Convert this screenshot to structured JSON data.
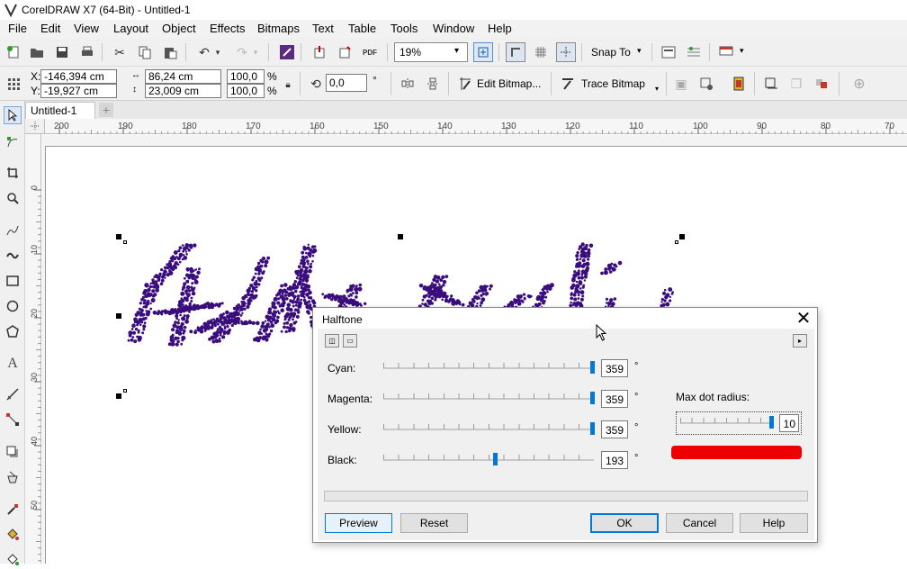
{
  "app": {
    "title": "CorelDRAW X7 (64-Bit) - Untitled-1"
  },
  "menu": [
    "File",
    "Edit",
    "View",
    "Layout",
    "Object",
    "Effects",
    "Bitmaps",
    "Text",
    "Table",
    "Tools",
    "Window",
    "Help"
  ],
  "toolbar": {
    "zoom_value": "19%",
    "snap_label": "Snap To"
  },
  "propbar": {
    "x_label": "X:",
    "x_value": "-146,394 cm",
    "y_label": "Y:",
    "y_value": "-19,927 cm",
    "width_value": "86,24 cm",
    "height_value": "23,009 cm",
    "scale_x": "100,0",
    "scale_y": "100,0",
    "pct1": "%",
    "pct2": "%",
    "rotation_value": "0,0",
    "deg": "°",
    "edit_bitmap_label": "Edit Bitmap...",
    "trace_bitmap_label": "Trace Bitmap"
  },
  "doc_tab": "Untitled-1",
  "hruler_ticks": [
    "200",
    "190",
    "180",
    "170",
    "160",
    "150",
    "140",
    "130",
    "120",
    "110",
    "100",
    "90",
    "80",
    "70"
  ],
  "vruler_ticks": [
    "0",
    "10",
    "20",
    "30",
    "40",
    "50"
  ],
  "dialog": {
    "title": "Halftone",
    "channels": [
      {
        "label": "Cyan:",
        "value": "359",
        "fraction": 0.997
      },
      {
        "label": "Magenta:",
        "value": "359",
        "fraction": 0.997
      },
      {
        "label": "Yellow:",
        "value": "359",
        "fraction": 0.997
      },
      {
        "label": "Black:",
        "value": "193",
        "fraction": 0.536
      }
    ],
    "degree_symbol": "°",
    "max_dot_label": "Max dot radius:",
    "max_dot_value": "10",
    "max_dot_fraction": 1.0,
    "preview_color": "#ee0000",
    "buttons": {
      "preview": "Preview",
      "reset": "Reset",
      "ok": "OK",
      "cancel": "Cancel",
      "help": "Help"
    }
  },
  "colors": {
    "halftone_ink": "#3a0d7e",
    "accent": "#0078d7"
  }
}
